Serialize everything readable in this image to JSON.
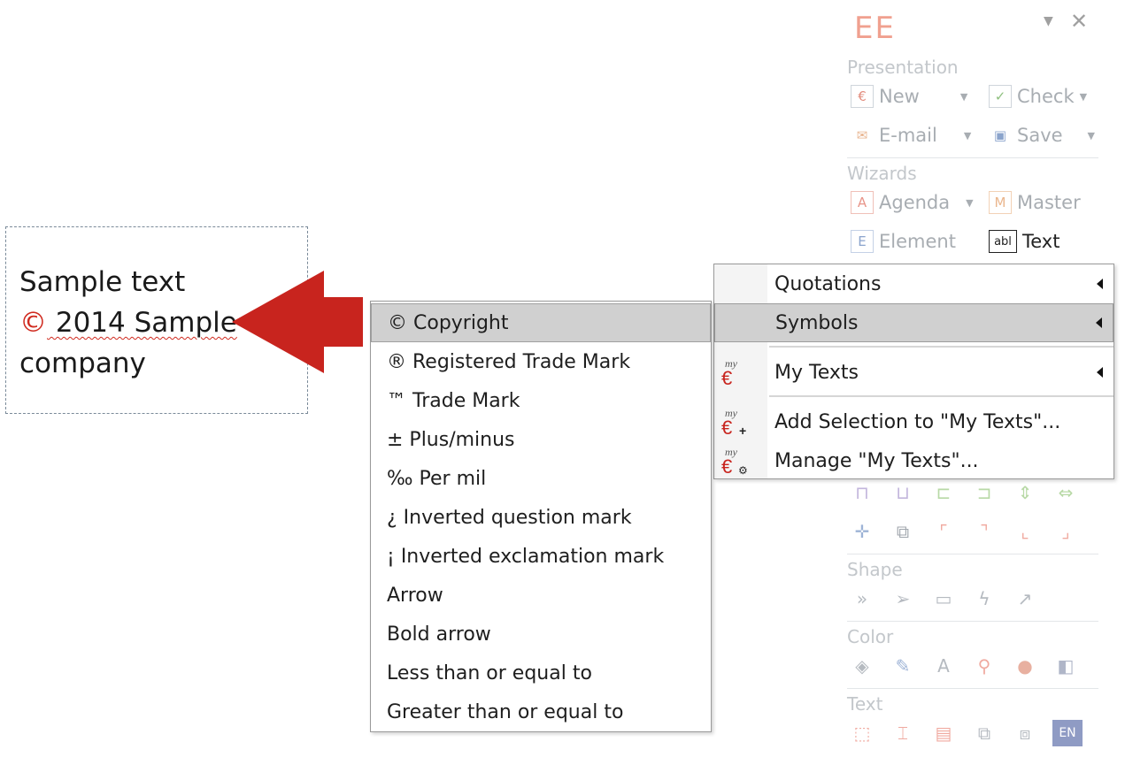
{
  "sample": {
    "line1": "Sample text",
    "symbol": "©",
    "line2_rest": " 2014 Sample",
    "line3": "company"
  },
  "panel": {
    "title": "EE",
    "sections": {
      "presentation": "Presentation",
      "wizards": "Wizards",
      "shape": "Shape",
      "color": "Color",
      "text": "Text"
    },
    "buttons": {
      "new": "New",
      "check": "Check",
      "email": "E-mail",
      "save": "Save",
      "agenda": "Agenda",
      "master": "Master",
      "element": "Element",
      "text": "Text"
    },
    "text_icon_glyph": "abl",
    "lang_badge": "EN"
  },
  "context_menu": {
    "items": [
      {
        "label": "Quotations",
        "submenu": true
      },
      {
        "label": "Symbols",
        "submenu": true,
        "highlighted": true
      },
      {
        "label": "My Texts",
        "submenu": true,
        "icon": "my-texts-icon"
      },
      {
        "label": "Add Selection to \"My Texts\"...",
        "icon": "my-texts-add-icon"
      },
      {
        "label": "Manage \"My Texts\"...",
        "icon": "my-texts-manage-icon"
      }
    ],
    "icon_caption": "my"
  },
  "symbols_submenu": {
    "items": [
      "© Copyright",
      "® Registered Trade Mark",
      "™ Trade Mark",
      "± Plus/minus",
      "‰ Per mil",
      "¿ Inverted question mark",
      "¡ Inverted exclamation mark",
      "Arrow",
      "Bold arrow",
      "Less than or equal to",
      "Greater than or equal to"
    ],
    "highlighted_index": 0
  },
  "colors": {
    "accent_red": "#c8241e",
    "highlight": "#d0d0d0"
  }
}
